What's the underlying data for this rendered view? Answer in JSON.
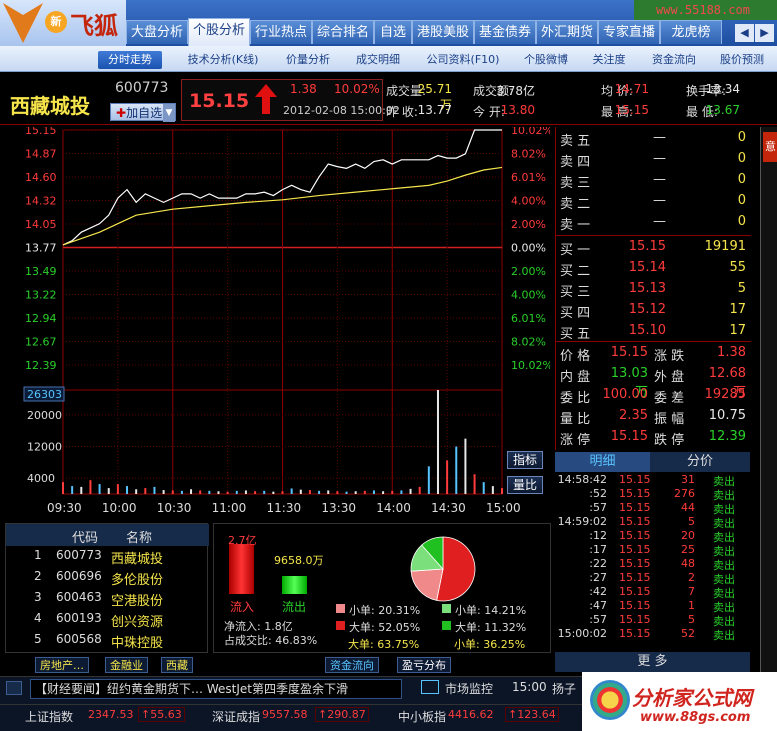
{
  "app": {
    "brand": "飞狐",
    "badge": "新",
    "site": "www.55188.com",
    "edge_label": "意"
  },
  "tabs": [
    "大盘分析",
    "个股分析",
    "行业热点",
    "综合排名",
    "自选",
    "港股美股",
    "基金债券",
    "外汇期货",
    "专家直播",
    "龙虎榜"
  ],
  "active_tab": 1,
  "nav_buttons": [
    "◀",
    "▶"
  ],
  "subtabs": [
    "分时走势",
    "技术分析(K线)",
    "价量分析",
    "成交明细",
    "公司资料(F10)",
    "个股微博",
    "关注度",
    "资金流向",
    "股价预测"
  ],
  "stock": {
    "name": "西藏城投",
    "code": "600773",
    "add_label": "加自选",
    "price": "15.15",
    "change": "1.38",
    "pct": "10.02%",
    "datetime": "2012-02-08 15:00:02"
  },
  "stats": [
    {
      "label": "成交量:",
      "value": "25.71万",
      "color": "yel"
    },
    {
      "label": "成交额:",
      "value": "3.78亿",
      "color": "white"
    },
    {
      "label": "均 价:",
      "value": "14.71",
      "color": "red"
    },
    {
      "label": "换手率:",
      "value": "13.34",
      "color": "white"
    },
    {
      "label": "昨 收:",
      "value": "13.77",
      "color": "white"
    },
    {
      "label": "今 开:",
      "value": "13.80",
      "color": "red"
    },
    {
      "label": "最 高:",
      "value": "15.15",
      "color": "red"
    },
    {
      "label": "最 低:",
      "value": "13.67",
      "color": "green"
    }
  ],
  "chart_data": {
    "type": "line",
    "x_ticks": [
      "09:30",
      "10:00",
      "10:30",
      "11:00",
      "11:30",
      "13:30",
      "14:00",
      "14:30",
      "15:00"
    ],
    "y_ticks": [
      "15.15",
      "14.87",
      "14.60",
      "14.32",
      "14.05",
      "13.77",
      "13.49",
      "13.22",
      "12.94",
      "12.67",
      "12.39"
    ],
    "pct_ticks": [
      "10.02%",
      "8.02%",
      "6.01%",
      "4.00%",
      "2.00%",
      "0.00%",
      "2.00%",
      "4.00%",
      "6.01%",
      "8.02%",
      "10.02%"
    ],
    "ylim": [
      12.39,
      15.15
    ],
    "prev_close": 13.77,
    "vol_ticks": [
      "26303",
      "20000",
      "12000",
      "4000"
    ],
    "vol_max": 26303,
    "series": [
      {
        "name": "price",
        "color": "#ffffff",
        "x": [
          0,
          1,
          2,
          3,
          4,
          5,
          6,
          7,
          8,
          9,
          10,
          11,
          12,
          13,
          14,
          15,
          16,
          17,
          18,
          19,
          20,
          21,
          22,
          23,
          24,
          25,
          26,
          27,
          28,
          29,
          30,
          31,
          32,
          33,
          34,
          35,
          36,
          37,
          38,
          39,
          40,
          41,
          42,
          43,
          44,
          45,
          46,
          47,
          48
        ],
        "values": [
          13.8,
          13.85,
          13.95,
          14.0,
          14.05,
          14.15,
          14.35,
          14.45,
          14.3,
          14.4,
          14.35,
          14.3,
          14.35,
          14.4,
          14.4,
          14.35,
          14.4,
          14.35,
          14.35,
          14.35,
          14.4,
          14.4,
          14.42,
          14.38,
          14.45,
          14.5,
          14.45,
          14.42,
          14.6,
          14.75,
          14.72,
          14.7,
          14.75,
          14.7,
          14.78,
          14.8,
          14.75,
          14.8,
          14.8,
          14.8,
          14.8,
          14.85,
          14.82,
          14.82,
          14.87,
          15.15,
          15.15,
          15.15,
          15.15
        ]
      },
      {
        "name": "avg",
        "color": "#f5e54b",
        "x": [
          0,
          4,
          8,
          12,
          16,
          20,
          24,
          28,
          32,
          36,
          40,
          42,
          44,
          46,
          48
        ],
        "values": [
          13.8,
          13.95,
          14.15,
          14.22,
          14.26,
          14.3,
          14.33,
          14.38,
          14.42,
          14.46,
          14.5,
          14.55,
          14.62,
          14.68,
          14.71
        ]
      }
    ],
    "volume": {
      "x": [
        0,
        1,
        2,
        3,
        4,
        5,
        6,
        7,
        8,
        9,
        10,
        11,
        12,
        13,
        14,
        15,
        16,
        17,
        18,
        19,
        20,
        21,
        22,
        23,
        24,
        25,
        26,
        27,
        28,
        29,
        30,
        31,
        32,
        33,
        34,
        35,
        36,
        37,
        38,
        39,
        40,
        41,
        42,
        43,
        44,
        45,
        46,
        47,
        48
      ],
      "values": [
        3000,
        2000,
        1800,
        3500,
        2500,
        1500,
        2500,
        2000,
        1200,
        1500,
        1800,
        1000,
        900,
        800,
        1200,
        900,
        800,
        700,
        600,
        800,
        900,
        700,
        800,
        600,
        700,
        1400,
        1100,
        1000,
        800,
        900,
        700,
        600,
        700,
        800,
        900,
        700,
        800,
        900,
        1300,
        1800,
        7000,
        26303,
        8500,
        12000,
        14000,
        5000,
        3000,
        2000,
        1500
      ]
    }
  },
  "chart_buttons": [
    "指标",
    "量比"
  ],
  "sell_orders": [
    {
      "label": "卖 五",
      "price": "—",
      "vol": "0"
    },
    {
      "label": "卖 四",
      "price": "—",
      "vol": "0"
    },
    {
      "label": "卖 三",
      "price": "—",
      "vol": "0"
    },
    {
      "label": "卖 二",
      "price": "—",
      "vol": "0"
    },
    {
      "label": "卖 一",
      "price": "—",
      "vol": "0"
    }
  ],
  "buy_orders": [
    {
      "label": "买 一",
      "price": "15.15",
      "vol": "19191"
    },
    {
      "label": "买 二",
      "price": "15.14",
      "vol": "55"
    },
    {
      "label": "买 三",
      "price": "15.13",
      "vol": "5"
    },
    {
      "label": "买 四",
      "price": "15.12",
      "vol": "17"
    },
    {
      "label": "买 五",
      "price": "15.10",
      "vol": "17"
    }
  ],
  "summary": [
    {
      "k1": "价 格",
      "v1": "15.15",
      "c1": "red",
      "k2": "涨 跌",
      "v2": "1.38",
      "c2": "red"
    },
    {
      "k1": "内 盘",
      "v1": "13.03万",
      "c1": "green",
      "k2": "外 盘",
      "v2": "12.68万",
      "c2": "red"
    },
    {
      "k1": "委 比",
      "v1": "100.00",
      "c1": "red",
      "k2": "委 差",
      "v2": "19285",
      "c2": "red"
    },
    {
      "k1": "量 比",
      "v1": "2.35",
      "c1": "red",
      "k2": "振 幅",
      "v2": "10.75",
      "c2": "white"
    },
    {
      "k1": "涨 停",
      "v1": "15.15",
      "c1": "red",
      "k2": "跌 停",
      "v2": "12.39",
      "c2": "green"
    }
  ],
  "tick_tabs": [
    "明细",
    "分价"
  ],
  "ticks": [
    {
      "t": "14:58:42",
      "p": "15.15",
      "v": "31",
      "s": "卖出"
    },
    {
      "t": ":52",
      "p": "15.15",
      "v": "276",
      "s": "卖出"
    },
    {
      "t": ":57",
      "p": "15.15",
      "v": "44",
      "s": "卖出"
    },
    {
      "t": "14:59:02",
      "p": "15.15",
      "v": "5",
      "s": "卖出"
    },
    {
      "t": ":12",
      "p": "15.15",
      "v": "20",
      "s": "卖出"
    },
    {
      "t": ":17",
      "p": "15.15",
      "v": "25",
      "s": "卖出"
    },
    {
      "t": ":22",
      "p": "15.15",
      "v": "48",
      "s": "卖出"
    },
    {
      "t": ":27",
      "p": "15.15",
      "v": "2",
      "s": "卖出"
    },
    {
      "t": ":42",
      "p": "15.15",
      "v": "7",
      "s": "卖出"
    },
    {
      "t": ":47",
      "p": "15.15",
      "v": "1",
      "s": "卖出"
    },
    {
      "t": ":57",
      "p": "15.15",
      "v": "5",
      "s": "卖出"
    },
    {
      "t": "15:00:02",
      "p": "15.15",
      "v": "52",
      "s": "卖出"
    }
  ],
  "more_label": "更 多",
  "rank": {
    "headers": [
      "代码",
      "名称"
    ],
    "rows": [
      {
        "n": "1",
        "code": "600773",
        "name": "西藏城投"
      },
      {
        "n": "2",
        "code": "600696",
        "name": "多伦股份"
      },
      {
        "n": "3",
        "code": "600463",
        "name": "空港股份"
      },
      {
        "n": "4",
        "code": "600193",
        "name": "创兴资源"
      },
      {
        "n": "5",
        "code": "600568",
        "name": "中珠控股"
      }
    ]
  },
  "rank_tags": [
    "房地产…",
    "金融业",
    "西藏"
  ],
  "flow": {
    "inflow_amt": "2.7亿",
    "outflow_amt": "9658.0万",
    "inflow_label": "流入",
    "outflow_label": "流出",
    "net": "净流入: 1.8亿",
    "ratio": "占成交比: 46.83%",
    "inflow_value": 2.7,
    "outflow_value": 0.9658,
    "small_in": "小单: 20.31%",
    "big_in": "大单: 52.05%",
    "small_out": "小单: 14.21%",
    "big_out": "大单: 11.32%",
    "total_big": "大单: 63.75%",
    "total_small": "小单: 36.25%",
    "pie": [
      {
        "name": "大单流入",
        "value": 52.05,
        "color": "#e02020"
      },
      {
        "name": "小单流入",
        "value": 20.31,
        "color": "#f08a8a"
      },
      {
        "name": "小单流出",
        "value": 14.21,
        "color": "#7be07b"
      },
      {
        "name": "大单流出",
        "value": 11.32,
        "color": "#20c020"
      }
    ]
  },
  "flow_tabs": [
    "资金流向",
    "盈亏分布"
  ],
  "news": "【财经要闻】纽约黄金期货下… WestJet第四季度盈余下滑",
  "monitor_label": "市场监控",
  "time_label": "15:00",
  "extra_label": "扬子",
  "indices": [
    {
      "name": "上证指数",
      "val": "2347.53",
      "chg": "↑55.63"
    },
    {
      "name": "深证成指",
      "val": "9557.58",
      "chg": "↑290.87"
    },
    {
      "name": "中小板指",
      "val": "4416.62",
      "chg": "↑123.64"
    }
  ],
  "ad": {
    "title": "分析家公式网",
    "url": "www.88gs.com"
  }
}
